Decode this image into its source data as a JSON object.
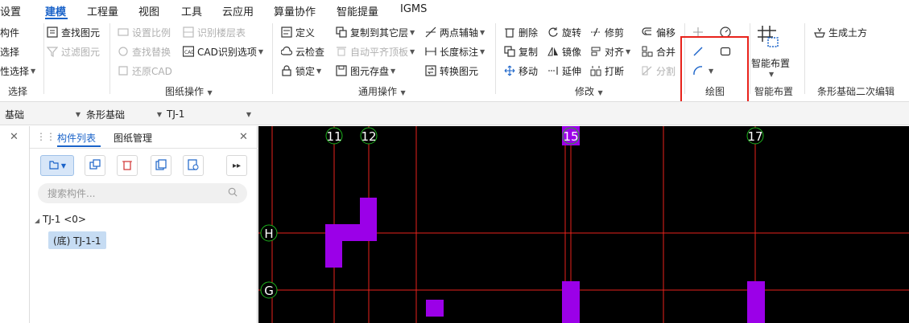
{
  "menu": {
    "items": [
      "设置",
      "建模",
      "工程量",
      "视图",
      "工具",
      "云应用",
      "算量协作",
      "智能提量",
      "IGMS"
    ],
    "active": "建模"
  },
  "ribbon": {
    "select_group": {
      "items": [
        "构件",
        "选择",
        "性选择"
      ],
      "label": "选择"
    },
    "drawing_ops": {
      "col1": [
        "查找图元",
        "过滤图元"
      ],
      "col2": [
        "设置比例",
        "查找替换",
        "还原CAD"
      ],
      "col3": [
        "识别楼层表",
        "CAD识别选项"
      ],
      "label": "图纸操作"
    },
    "common_ops": {
      "col1": [
        "定义",
        "云检查",
        "锁定"
      ],
      "col2": [
        "复制到其它层",
        "自动平齐顶板",
        "图元存盘"
      ],
      "col3": [
        "两点辅轴",
        "长度标注",
        "转换图元"
      ],
      "label": "通用操作"
    },
    "modify": {
      "col1": [
        "删除",
        "复制",
        "移动"
      ],
      "col2": [
        "旋转",
        "镜像",
        "延伸"
      ],
      "col3": [
        "修剪",
        "对齐",
        "打断"
      ],
      "col4": [
        "偏移",
        "合并",
        "分割"
      ],
      "label": "修改"
    },
    "draw": {
      "label": "绘图"
    },
    "smart_layout": {
      "button": "智能布置",
      "label": "智能布置"
    },
    "strip_edit": {
      "button": "生成土方",
      "label": "条形基础二次编辑"
    }
  },
  "propbar": {
    "dropdowns": [
      "基础",
      "条形基础",
      "TJ-1"
    ]
  },
  "panel": {
    "tabs": [
      "构件列表",
      "图纸管理"
    ],
    "search_placeholder": "搜索构件...",
    "tree_parent": "TJ-1 <0>",
    "tree_child": "(底) TJ-1-1"
  },
  "canvas": {
    "axis_labels_top": [
      "11",
      "12",
      "15",
      "17"
    ],
    "axis_labels_left": [
      "H",
      "G"
    ],
    "colors": {
      "background": "#000000",
      "grid": "#e8221b",
      "element": "#9b00e8",
      "axis_circle": "#1db31d"
    }
  }
}
